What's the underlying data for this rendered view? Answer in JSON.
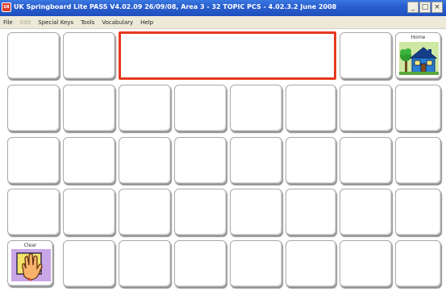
{
  "window": {
    "title": "UK Springboard Lite PASS V4.02.09 26/09/08, Area 3 - 32 TOPIC PCS - 4.02.3.2 June 2008",
    "icon_text": "SB",
    "minimize": "_",
    "maximize": "□",
    "close": "×"
  },
  "menu": {
    "items": [
      {
        "label": "File",
        "enabled": true
      },
      {
        "label": "Edit",
        "enabled": false
      },
      {
        "label": "Special Keys",
        "enabled": true
      },
      {
        "label": "Tools",
        "enabled": true
      },
      {
        "label": "Vocabulary",
        "enabled": true
      },
      {
        "label": "Help",
        "enabled": true
      }
    ]
  },
  "keys": {
    "home": {
      "label": "Home",
      "icon": "house-icon"
    },
    "clear": {
      "label": "Clear",
      "icon": "wipe-hand-icon"
    }
  },
  "colors": {
    "message_border": "#e8391f",
    "home_background": "#cfe7a4",
    "clear_background": "#c9a6e6"
  }
}
